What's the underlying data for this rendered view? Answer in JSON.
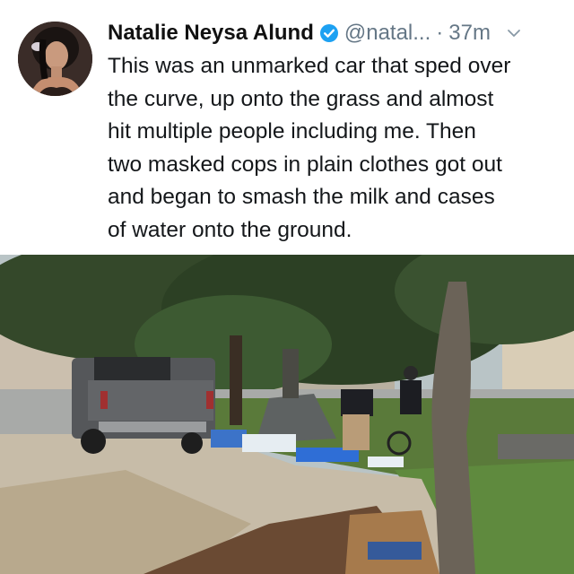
{
  "tweet": {
    "author_name": "Natalie Neysa Alund",
    "handle": "@natal...",
    "separator": "·",
    "timestamp": "37m",
    "text": "This was an unmarked car that sped over\nthe curve, up onto the grass and almost\nhit multiple people including me. Then\ntwo masked cops in plain clothes got out\nand began to smash the milk and cases\nof water onto the ground."
  },
  "icons": {
    "verified": "verified-badge-icon",
    "more": "chevron-down-icon"
  },
  "colors": {
    "verified_blue": "#1da1f2",
    "muted_gray": "#657786",
    "text_dark": "#14171a"
  }
}
